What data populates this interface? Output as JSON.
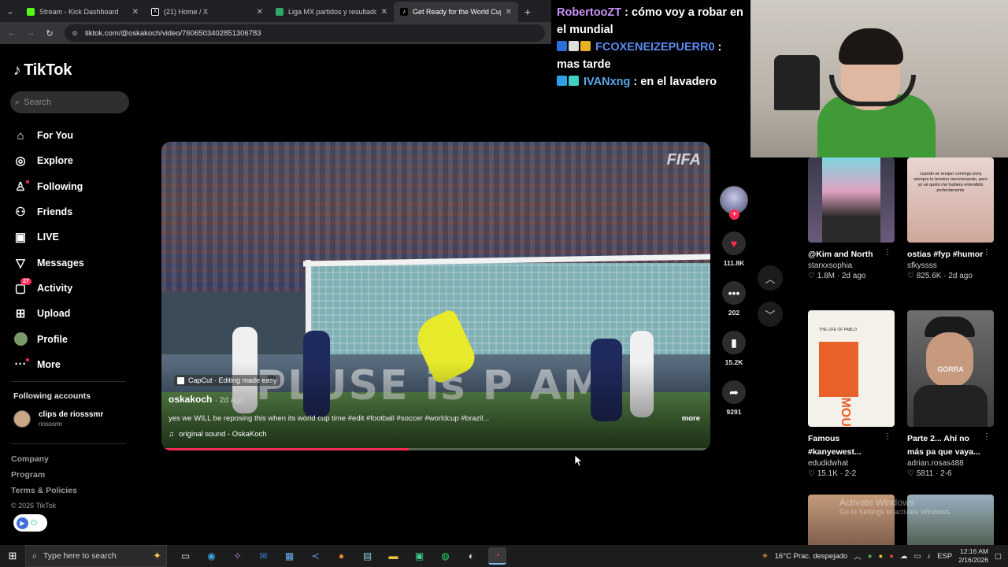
{
  "browser": {
    "tabs": [
      {
        "title": "Stream - Kick Dashboard",
        "color": "#53fc18",
        "active": false
      },
      {
        "title": "(21) Home / X",
        "color": "#ffffff",
        "active": false
      },
      {
        "title": "Liga MX partidos y resultados",
        "color": "#2fa86b",
        "active": false
      },
      {
        "title": "Get Ready for the World Cup w",
        "color": "#000000",
        "active": true
      }
    ],
    "new_tab": "+",
    "url": "tiktok.com/@oskakoch/video/7606503402851306783"
  },
  "tiktok": {
    "logo": "TikTok",
    "search_placeholder": "Search",
    "nav": [
      {
        "label": "For You",
        "icon": "home-icon"
      },
      {
        "label": "Explore",
        "icon": "compass-icon"
      },
      {
        "label": "Following",
        "icon": "following-icon"
      },
      {
        "label": "Friends",
        "icon": "friends-icon"
      },
      {
        "label": "LIVE",
        "icon": "live-icon"
      },
      {
        "label": "Messages",
        "icon": "messages-icon"
      },
      {
        "label": "Activity",
        "icon": "activity-icon",
        "badge": "27"
      },
      {
        "label": "Upload",
        "icon": "upload-icon"
      },
      {
        "label": "Profile",
        "icon": "profile-avatar"
      },
      {
        "label": "More",
        "icon": "more-icon"
      }
    ],
    "following_title": "Following accounts",
    "following": [
      {
        "name": "clips de riosssmr",
        "handle": "riosssmr"
      }
    ],
    "footer": [
      "Company",
      "Program",
      "Terms & Policies"
    ],
    "copyright": "© 2026 TikTok"
  },
  "video": {
    "capcut": "CapCut · Editing made easy",
    "author": "oskakoch",
    "date": "· 2d ago",
    "caption": "yes we WILL be reposing this when its world cup time #edit #football #soccer #worldcup #brazil...",
    "more": "more",
    "sound": "original sound - OskaKoch",
    "watermark": "FIFA",
    "progress": 0.45,
    "likes": "111.8K",
    "comments": "202",
    "saves": "15.2K",
    "shares": "9291"
  },
  "chat": [
    {
      "user": "RobertooZT",
      "sep": " : ",
      "msg": "cómo voy a robar en el mundial"
    },
    {
      "user": "FCOXENEIZEPUERR0",
      "sep": " : ",
      "msg": "mas tarde"
    },
    {
      "user": "IVANxng",
      "sep": " : ",
      "msg": "en el lavadero"
    }
  ],
  "grid": [
    {
      "title": "@Kim and North",
      "user": "starxxsophia",
      "stats": "♡ 1.8M · 2d ago"
    },
    {
      "title": "ostias #fyp #humor",
      "user": "sfkyssss",
      "stats": "♡ 825.6K · 2d ago",
      "thumb_text": "cuando se enojan conmigo porq siempre lo termino mencionando, pero yo sé quién me hubiera entendido perfectamente"
    },
    {
      "title": "Famous #kanyewest...",
      "user": "edudidwhat",
      "stats": "♡ 15.1K · 2-2",
      "thumb_text": "FAMOUS",
      "thumb_sub": "THE LIFE OF PABLO"
    },
    {
      "title": "Parte 2... Ahí no más pa que vaya...",
      "user": "adrian.rosas488",
      "stats": "♡ 5811 · 2-6",
      "thumb_text": "GORRA"
    }
  ],
  "activate": {
    "title": "Activate Windows",
    "sub": "Go to Settings to activate Windows."
  },
  "taskbar": {
    "search": "Type here to search",
    "weather": "16°C  Prac. despejado",
    "lang": "ESP",
    "time": "12:16 AM",
    "date": "2/16/2026"
  }
}
